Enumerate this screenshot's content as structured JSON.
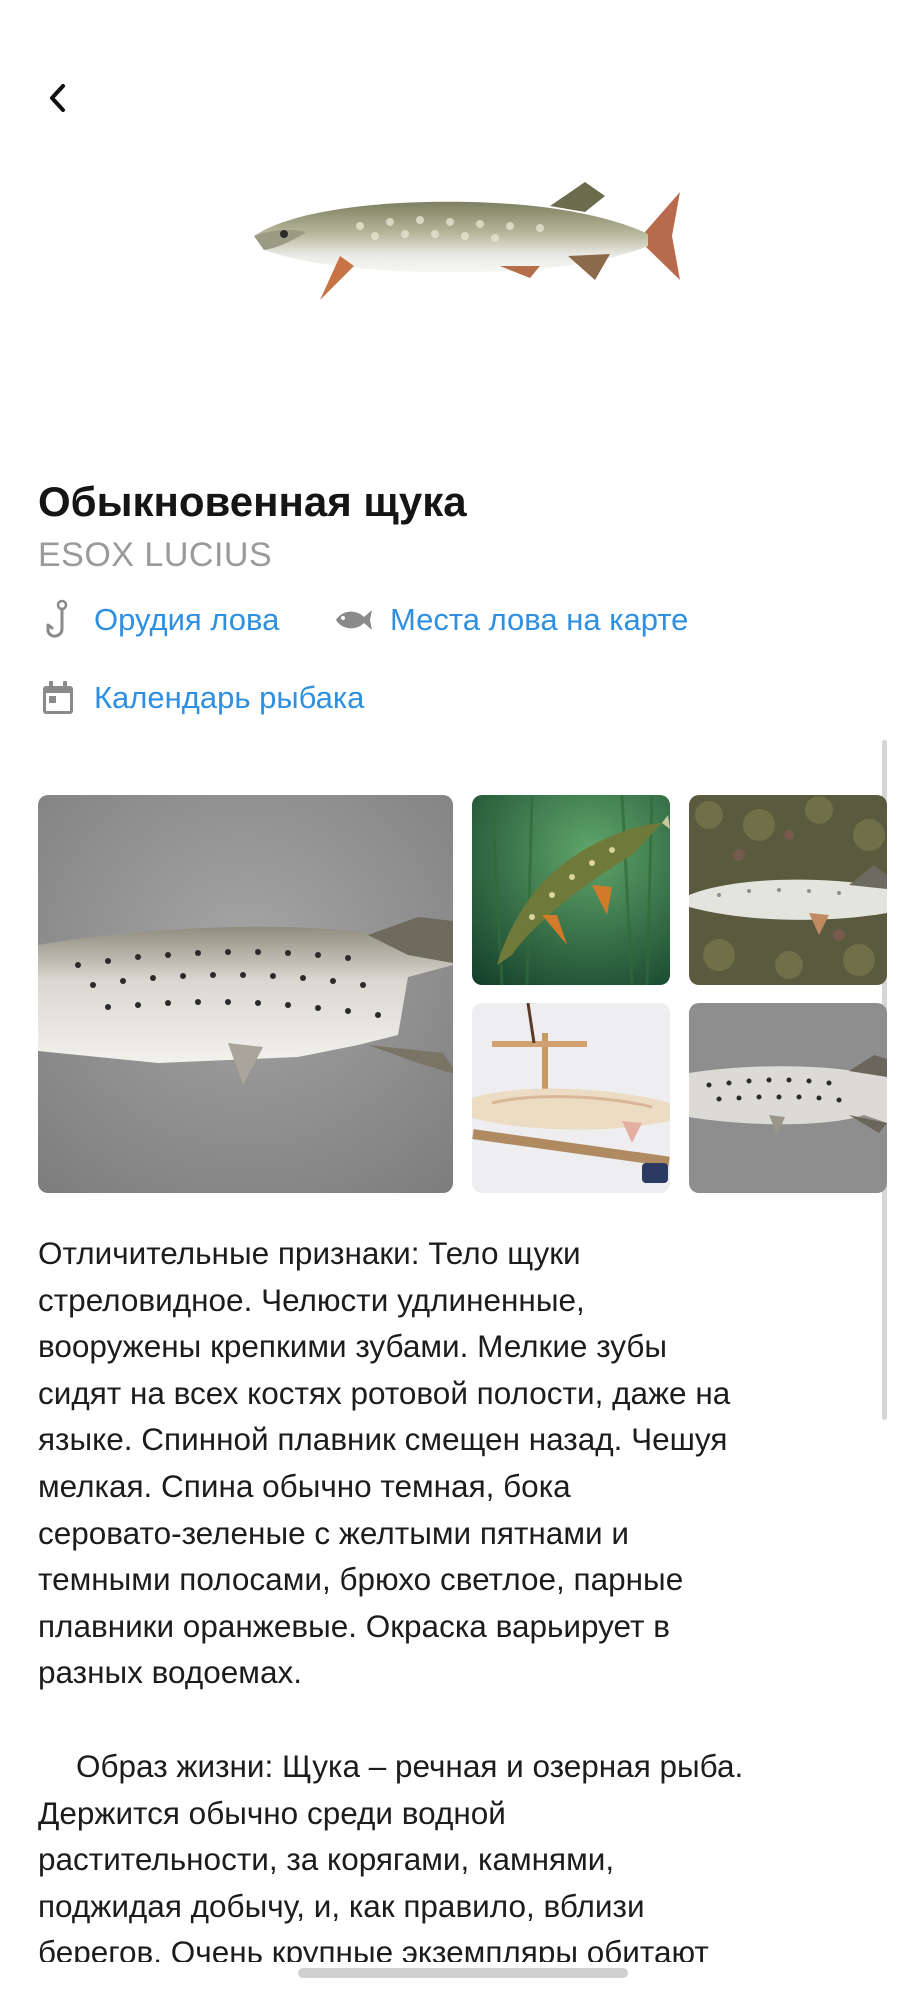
{
  "header": {
    "back_icon": "chevron-left-icon"
  },
  "fish": {
    "name": "Обыкновенная щука",
    "latin_name": "ESOX LUCIUS"
  },
  "links": [
    {
      "label": "Орудия лова",
      "icon": "fishing-hook-icon"
    },
    {
      "label": "Места лова на карте",
      "icon": "fish-icon"
    },
    {
      "label": "Календарь рыбака",
      "icon": "calendar-icon"
    }
  ],
  "colors": {
    "accent": "#2f8fe0",
    "title": "#151515",
    "latin": "#9a9a9a",
    "text": "#1c1c1c"
  },
  "gallery": {
    "image_count": 5
  },
  "description": {
    "paragraph1": "Отличительные признаки: Тело щуки\nстреловидное. Челюсти удлиненные,\nвооружены крепкими зубами. Мелкие зубы\nсидят на всех костях ротовой полости, даже на\nязыке. Спинной плавник смещен назад. Чешуя\nмелкая. Спина обычно темная, бока\nсеровато-зеленые с желтыми пятнами и\nтемными полосами, брюхо светлое, парные\nплавники оранжевые. Окраска варьирует в\nразных водоемах.",
    "paragraph2": "Образ жизни: Щука – речная и озерная рыба.\nДержится обычно среди водной\nрастительности, за корягами, камнями,\nподжидая добычу, и, как правило, вблизи\nберегов. Очень крупные экземпляры обитают"
  }
}
